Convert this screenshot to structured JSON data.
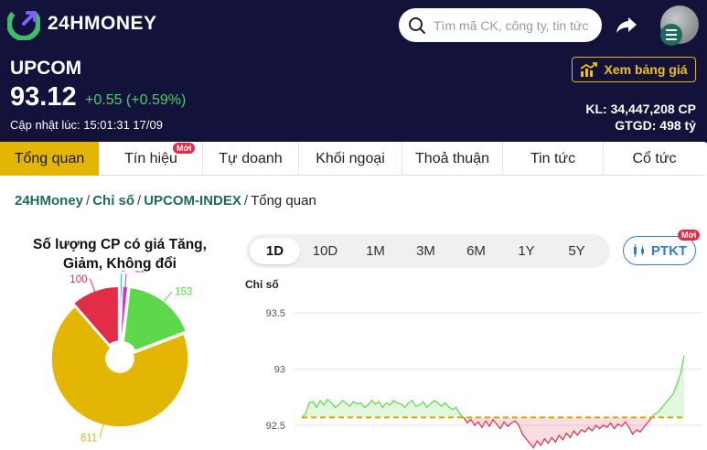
{
  "brand": {
    "name": "24HMONEY",
    "color": "#44b96a"
  },
  "search": {
    "placeholder": "Tìm mã CK, công ty, tin tức"
  },
  "quote": {
    "symbol": "UPCOM",
    "price": "93.12",
    "change": "+0.55 (+0.59%)",
    "updated": "Cập nhật lúc: 15:01:31 17/09",
    "volume": "KL: 34,447,208 CP",
    "value": "GTGD: 498 tỷ",
    "watch_button": "Xem bảng giá"
  },
  "tabs": [
    {
      "label": "Tổng quan",
      "active": true
    },
    {
      "label": "Tín hiệu",
      "badge": "Mới"
    },
    {
      "label": "Tự doanh"
    },
    {
      "label": "Khối ngoại"
    },
    {
      "label": "Thoả thuận"
    },
    {
      "label": "Tin tức"
    },
    {
      "label": "Cổ tức"
    }
  ],
  "breadcrumb": {
    "items": [
      "24HMoney",
      "Chỉ số",
      "UPCOM-INDEX"
    ],
    "current": "Tổng quan",
    "separator": "/"
  },
  "pie_chart": {
    "title_line1": "Số lượng CP có giá Tăng,",
    "title_line2": "Giảm, Không đổi",
    "chart_data": {
      "type": "pie",
      "slices": [
        {
          "label": "5",
          "value": 5,
          "color": "#3bb4e6"
        },
        {
          "label": "11",
          "value": 11,
          "color": "#cc33cc"
        },
        {
          "label": "153",
          "value": 153,
          "color": "#5cd84a"
        },
        {
          "label": "611",
          "value": 611,
          "color": "#e3b505"
        },
        {
          "label": "100",
          "value": 100,
          "color": "#e22d49"
        }
      ]
    }
  },
  "ranges": [
    {
      "label": "1D",
      "active": true
    },
    {
      "label": "10D"
    },
    {
      "label": "1M"
    },
    {
      "label": "3M"
    },
    {
      "label": "6M"
    },
    {
      "label": "1Y"
    },
    {
      "label": "5Y"
    }
  ],
  "ptkt": {
    "label": "PTKT",
    "badge": "Mới"
  },
  "line_chart": {
    "ylabel": "Chỉ số",
    "chart_data": {
      "type": "area",
      "yticks": [
        "93.5",
        "93",
        "92.5"
      ],
      "ylim": [
        92.28,
        93.68
      ],
      "reference": 92.57,
      "up_color": "#5cd84a",
      "down_color": "#e22d49",
      "reference_color": "#d4a904",
      "values": [
        92.57,
        92.6,
        92.7,
        92.71,
        92.66,
        92.72,
        92.68,
        92.73,
        92.7,
        92.66,
        92.68,
        92.72,
        92.7,
        92.67,
        92.71,
        92.69,
        92.7,
        92.66,
        92.68,
        92.72,
        92.69,
        92.71,
        92.66,
        92.7,
        92.68,
        92.72,
        92.7,
        92.69,
        92.66,
        92.7,
        92.72,
        92.67,
        92.68,
        92.71,
        92.66,
        92.69,
        92.72,
        92.7,
        92.67,
        92.7,
        92.66,
        92.64,
        92.66,
        92.6,
        92.57,
        92.52,
        92.55,
        92.5,
        92.53,
        92.48,
        92.54,
        92.49,
        92.55,
        92.51,
        92.47,
        92.53,
        92.49,
        92.52,
        92.54,
        92.5,
        92.42,
        92.38,
        92.34,
        92.3,
        92.36,
        92.32,
        92.38,
        92.34,
        92.39,
        92.35,
        92.41,
        92.37,
        92.43,
        92.39,
        92.45,
        92.41,
        92.46,
        92.44,
        92.48,
        92.45,
        92.5,
        92.47,
        92.5,
        92.48,
        92.52,
        92.47,
        92.51,
        92.49,
        92.53,
        92.48,
        92.42,
        92.46,
        92.44,
        92.48,
        92.52,
        92.56,
        92.6,
        92.62,
        92.66,
        92.7,
        92.74,
        92.78,
        92.86,
        92.96,
        93.12
      ]
    }
  }
}
